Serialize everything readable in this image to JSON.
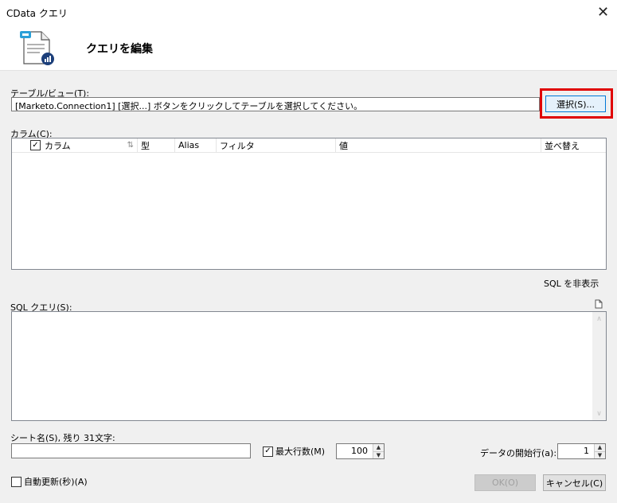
{
  "window": {
    "title": "CData クエリ",
    "close_glyph": "✕"
  },
  "header": {
    "title": "クエリを編集",
    "icon": "cdata-query-document-icon"
  },
  "table_view": {
    "label": "テーブル/ビュー(T):",
    "value": "[Marketo.Connection1] [選択...] ボタンをクリックしてテーブルを選択してください。",
    "select_button": "選択(S)...",
    "highlight_color": "#e00000"
  },
  "columns": {
    "label": "カラム(C):",
    "headers": {
      "column": "カラム",
      "type": "型",
      "alias": "Alias",
      "filter": "フィルタ",
      "value": "値",
      "sort": "並べ替え"
    },
    "select_all_checked": true,
    "sort_icon": "sort-arrows-icon"
  },
  "sql": {
    "toggle_link": "SQL を非表示",
    "label": "SQL クエリ(S):",
    "query": "",
    "copy_icon": "document-icon"
  },
  "sheet": {
    "label": "シート名(S), 残り 31文字:",
    "value": ""
  },
  "max_rows": {
    "label": "最大行数(M)",
    "checked": true,
    "value": "100"
  },
  "start_row": {
    "label": "データの開始行(a):",
    "value": "1"
  },
  "auto_refresh": {
    "label": "自動更新(秒)(A)",
    "checked": false
  },
  "buttons": {
    "ok": "OK(O)",
    "cancel": "キャンセル(C)"
  }
}
